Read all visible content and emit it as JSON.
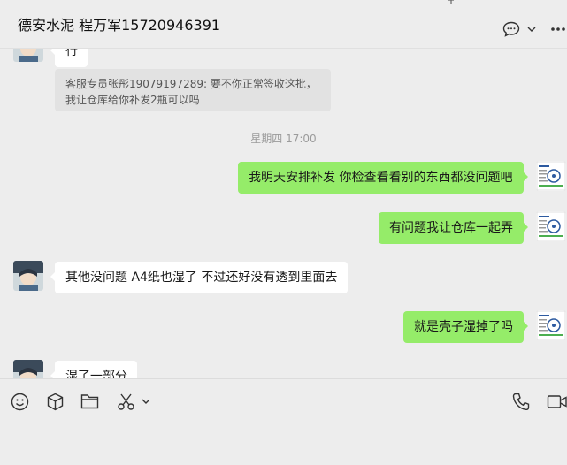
{
  "window": {
    "title": "德安水泥 程万军15720946391",
    "controls": [
      "pin-icon",
      "minimize-icon",
      "maximize-icon",
      "close-icon"
    ]
  },
  "header_actions": [
    "chat-bubble-icon",
    "chevron-down-icon",
    "more-icon"
  ],
  "messages": [
    {
      "side": "in",
      "type": "text",
      "text": "行"
    },
    {
      "side": "in",
      "type": "quote",
      "text": "客服专员张彤19079197289: 要不你正常签收这批，我让仓库给你补发2瓶可以吗"
    },
    {
      "type": "time",
      "text": "星期四 17:00"
    },
    {
      "side": "out",
      "type": "text",
      "text": "我明天安排补发 你检查看看别的东西都没问题吧"
    },
    {
      "side": "out",
      "type": "text",
      "text": "有问题我让仓库一起弄"
    },
    {
      "side": "in",
      "type": "text",
      "text": "其他没问题 A4纸也湿了 不过还好没有透到里面去"
    },
    {
      "side": "out",
      "type": "text",
      "text": "就是壳子湿掉了吗"
    },
    {
      "side": "in",
      "type": "text",
      "text": "湿了一部分"
    }
  ],
  "input_toolbar": [
    "emoji-icon",
    "cube-icon",
    "folder-icon",
    "scissors-icon",
    "chevron-down-icon",
    "phone-icon",
    "video-icon"
  ],
  "colors": {
    "background": "#ededed",
    "outgoing_bubble": "#95ec69",
    "incoming_bubble": "#ffffff",
    "quote_bg": "#e2e2e2"
  }
}
